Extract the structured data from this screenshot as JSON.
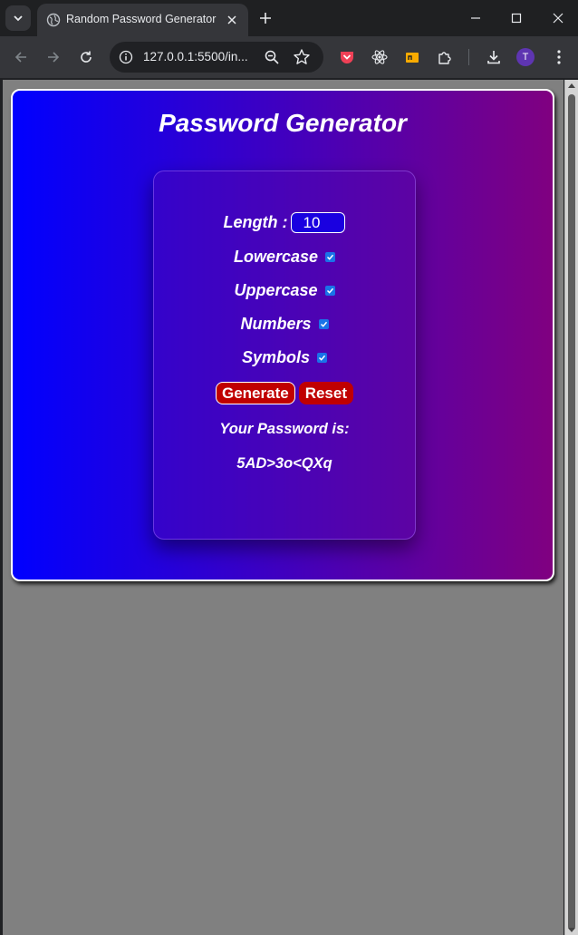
{
  "browser": {
    "tab_title": "Random Password Generator",
    "url": "127.0.0.1:5500/in...",
    "profile_initial": "T"
  },
  "app": {
    "title": "Password Generator",
    "length_label": "Length :",
    "length_value": "10",
    "options": [
      {
        "label": "Lowercase",
        "checked": true
      },
      {
        "label": "Uppercase",
        "checked": true
      },
      {
        "label": "Numbers",
        "checked": true
      },
      {
        "label": "Symbols",
        "checked": true
      }
    ],
    "generate_label": "Generate",
    "reset_label": "Reset",
    "result_label": "Your Password is:",
    "password": "5AD>3o<QXq"
  },
  "colors": {
    "gradient_start": "#0000ff",
    "gradient_end": "#800080",
    "button_red": "#c00000",
    "page_background": "#808080"
  }
}
